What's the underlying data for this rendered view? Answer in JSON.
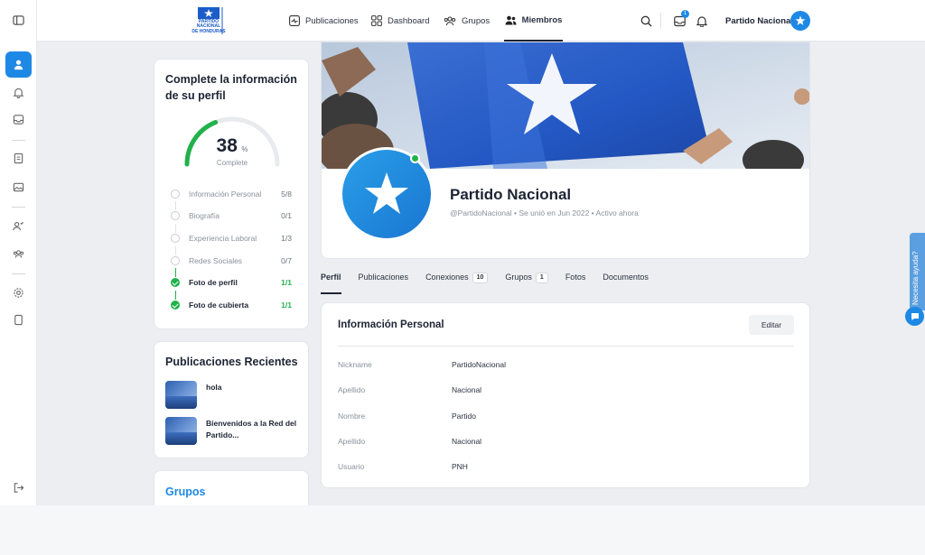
{
  "brand": {
    "logo_text_1": "PARTIDO",
    "logo_text_2": "NACIONAL",
    "logo_text_3": "DE HONDURAS"
  },
  "nav": {
    "items": [
      {
        "label": "Publicaciones",
        "icon": "activity-icon"
      },
      {
        "label": "Dashboard",
        "icon": "grid-icon"
      },
      {
        "label": "Grupos",
        "icon": "group-icon"
      },
      {
        "label": "Miembros",
        "icon": "members-icon"
      }
    ],
    "active": "Miembros"
  },
  "topbar": {
    "inbox_count": "1",
    "user_name": "Partido Nacional"
  },
  "profile_completion": {
    "title": "Complete la información de su perfil",
    "percent": "38",
    "percent_sign": "%",
    "percent_value": 0.38,
    "label": "Complete",
    "steps": [
      {
        "label": "Información Personal",
        "count": "5/8",
        "done": false
      },
      {
        "label": "Biografía",
        "count": "0/1",
        "done": false
      },
      {
        "label": "Experiencia Laboral",
        "count": "1/3",
        "done": false
      },
      {
        "label": "Redes Sociales",
        "count": "0/7",
        "done": false
      },
      {
        "label": "Foto de perfil",
        "count": "1/1",
        "done": true
      },
      {
        "label": "Foto de cubierta",
        "count": "1/1",
        "done": true
      }
    ]
  },
  "recent_posts": {
    "title": "Publicaciones Recientes",
    "items": [
      {
        "title": "hola"
      },
      {
        "title_line1": "Bienvenidos a la Red del",
        "title_line2": "Partido..."
      }
    ]
  },
  "groups": {
    "title": "Grupos"
  },
  "profile": {
    "name": "Partido Nacional",
    "meta": "@PartidoNacional • Se unió en Jun 2022 • Activo ahora",
    "online": true
  },
  "tabs": [
    {
      "label": "Perfil",
      "active": true
    },
    {
      "label": "Publicaciones"
    },
    {
      "label": "Conexiones",
      "count": "10"
    },
    {
      "label": "Grupos",
      "count": "1"
    },
    {
      "label": "Fotos"
    },
    {
      "label": "Documentos"
    }
  ],
  "personal_info": {
    "title": "Información Personal",
    "edit_label": "Editar",
    "rows": [
      {
        "key": "Nickname",
        "value": "PartidoNacional"
      },
      {
        "key": "Apellido",
        "value": "Nacional"
      },
      {
        "key": "Nombre",
        "value": "Partido"
      },
      {
        "key": "Apellido",
        "value": "Nacional"
      },
      {
        "key": "Usuario",
        "value": "PNH"
      }
    ]
  },
  "help": {
    "label": "Necesita ayuda?"
  },
  "colors": {
    "accent": "#1e88e5",
    "success": "#22b24c",
    "flag_blue": "#1b5cc8"
  }
}
